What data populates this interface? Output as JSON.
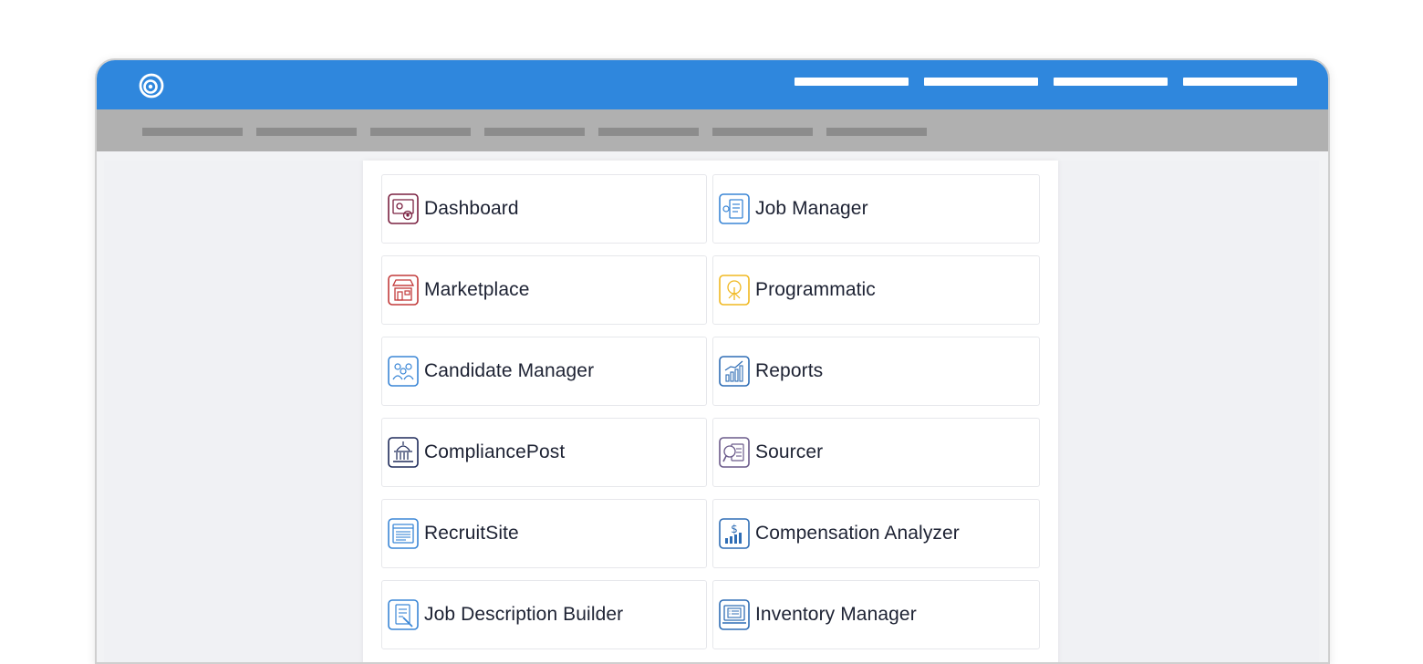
{
  "apps": [
    {
      "label": "Dashboard",
      "icon": "dashboard-icon",
      "color": "#7a2040"
    },
    {
      "label": "Job Manager",
      "icon": "job-manager-icon",
      "color": "#3a86d6"
    },
    {
      "label": "Marketplace",
      "icon": "marketplace-icon",
      "color": "#c23a3a"
    },
    {
      "label": "Programmatic",
      "icon": "programmatic-icon",
      "color": "#f0b820"
    },
    {
      "label": "Candidate Manager",
      "icon": "candidate-manager-icon",
      "color": "#3a86d6"
    },
    {
      "label": "Reports",
      "icon": "reports-icon",
      "color": "#2f6db5"
    },
    {
      "label": "CompliancePost",
      "icon": "compliance-post-icon",
      "color": "#1e2a5a"
    },
    {
      "label": "Sourcer",
      "icon": "sourcer-icon",
      "color": "#6a5a8a"
    },
    {
      "label": "RecruitSite",
      "icon": "recruit-site-icon",
      "color": "#3a86d6"
    },
    {
      "label": "Compensation Analyzer",
      "icon": "compensation-analyzer-icon",
      "color": "#2f6db5"
    },
    {
      "label": "Job Description Builder",
      "icon": "job-description-builder-icon",
      "color": "#3a86d6"
    },
    {
      "label": "Inventory Manager",
      "icon": "inventory-manager-icon",
      "color": "#2f6db5"
    }
  ],
  "colors": {
    "topbar": "#2f87dd",
    "subbar": "#b0b0b0",
    "content_background": "#f0f1f4"
  }
}
